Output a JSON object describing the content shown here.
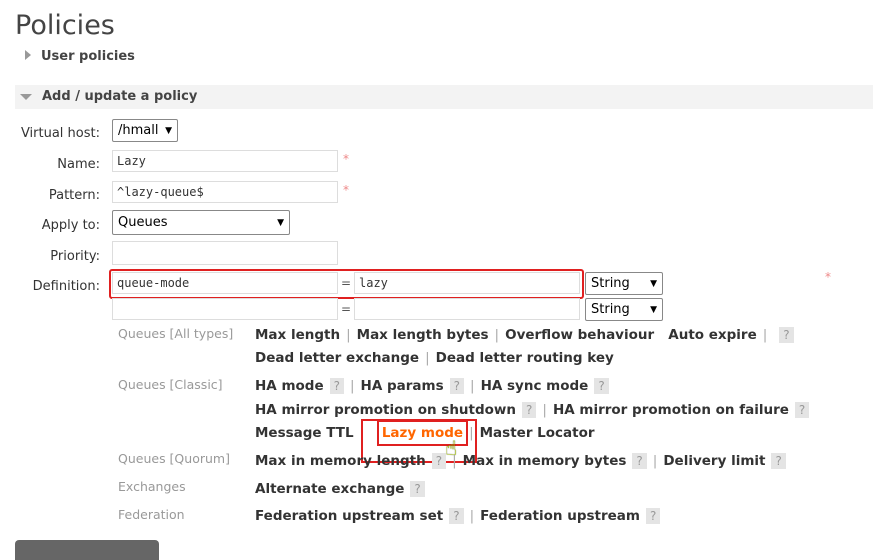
{
  "title": "Policies",
  "sections": {
    "user_policies": "User policies",
    "add_update": "Add / update a policy"
  },
  "form": {
    "vhost": {
      "label": "Virtual host:",
      "value": "/hmall"
    },
    "name": {
      "label": "Name:",
      "value": "Lazy",
      "required": "*"
    },
    "pattern": {
      "label": "Pattern:",
      "value": "^lazy-queue$",
      "required": "*"
    },
    "apply_to": {
      "label": "Apply to:",
      "value": "Queues"
    },
    "priority": {
      "label": "Priority:",
      "value": ""
    },
    "definition": {
      "label": "Definition:",
      "required": "*",
      "eq": "=",
      "rows": [
        {
          "key": "queue-mode",
          "value": "lazy",
          "type": "String"
        },
        {
          "key": "",
          "value": "",
          "type": "String"
        }
      ]
    }
  },
  "help": {
    "queues_all": {
      "label": "Queues [All types]",
      "l1": [
        "Max length",
        "Max length bytes",
        "Overflow behaviour",
        "Auto expire"
      ],
      "l2": [
        "Dead letter exchange",
        "Dead letter routing key"
      ]
    },
    "queues_classic": {
      "label": "Queues [Classic]",
      "l1": [
        "HA mode",
        "HA params",
        "HA sync mode"
      ],
      "l2": [
        "HA mirror promotion on shutdown",
        "HA mirror promotion on failure"
      ],
      "l3": [
        "Message TTL",
        "Lazy mode",
        "Master Locator"
      ]
    },
    "queues_quorum": {
      "label": "Queues [Quorum]",
      "l1": [
        "Max in memory length",
        "Max in memory bytes",
        "Delivery limit"
      ]
    },
    "exchanges": {
      "label": "Exchanges",
      "l1": [
        "Alternate exchange"
      ]
    },
    "federation": {
      "label": "Federation",
      "l1": [
        "Federation upstream set",
        "Federation upstream"
      ]
    },
    "sep": "|",
    "q": "?"
  },
  "colors": {
    "highlight": "#e02020",
    "active_link": "#ff6600"
  }
}
